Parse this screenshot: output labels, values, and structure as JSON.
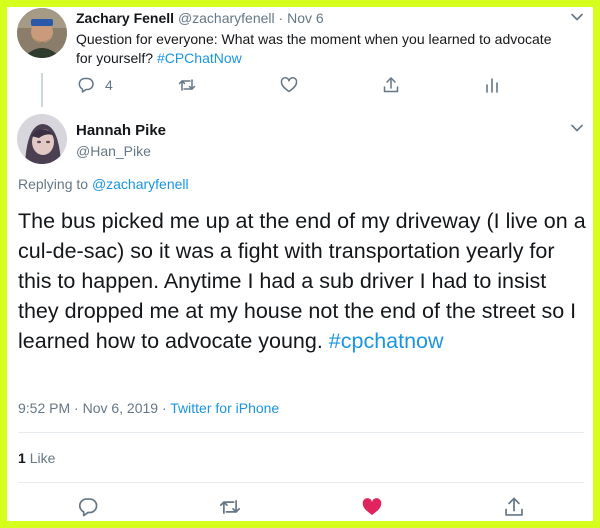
{
  "tweet1": {
    "author_name": "Zachary Fenell",
    "author_handle": "@zacharyfenell",
    "separator": "·",
    "date": "Nov 6",
    "text_main": "Question for everyone: What was the moment when you learned to advocate for yourself?",
    "hashtag": "#CPChatNow",
    "reply_count": "4",
    "icons": [
      "reply-icon",
      "retweet-icon",
      "like-icon",
      "share-icon",
      "analytics-icon",
      "chevron-down-icon"
    ]
  },
  "tweet2": {
    "author_name": "Hannah Pike",
    "author_handle": "@Han_Pike",
    "replying_prefix": "Replying to",
    "replying_to": "@zacharyfenell",
    "text_main": "The bus picked me up at the end of my driveway (I live on a cul-de-sac) so it was a fight with transportation yearly for this to happen. Anytime I had a sub driver I had to insist they dropped me at my house not the end of the street so I learned how to advocate young.",
    "hashtag": "#cpchatnow",
    "timestamp": "9:52 PM · Nov 6, 2019",
    "meta_separator": "·",
    "source": "Twitter for iPhone",
    "like_count": "1",
    "like_label": "Like",
    "liked": true,
    "icons": [
      "reply-icon",
      "retweet-icon",
      "heart-filled-icon",
      "share-icon",
      "chevron-down-icon"
    ]
  },
  "colors": {
    "frame_border": "#d7ff1e",
    "link": "#1b95e0",
    "muted": "#657786",
    "like_red": "#e0245e",
    "thread_line": "#ccd6dd"
  }
}
